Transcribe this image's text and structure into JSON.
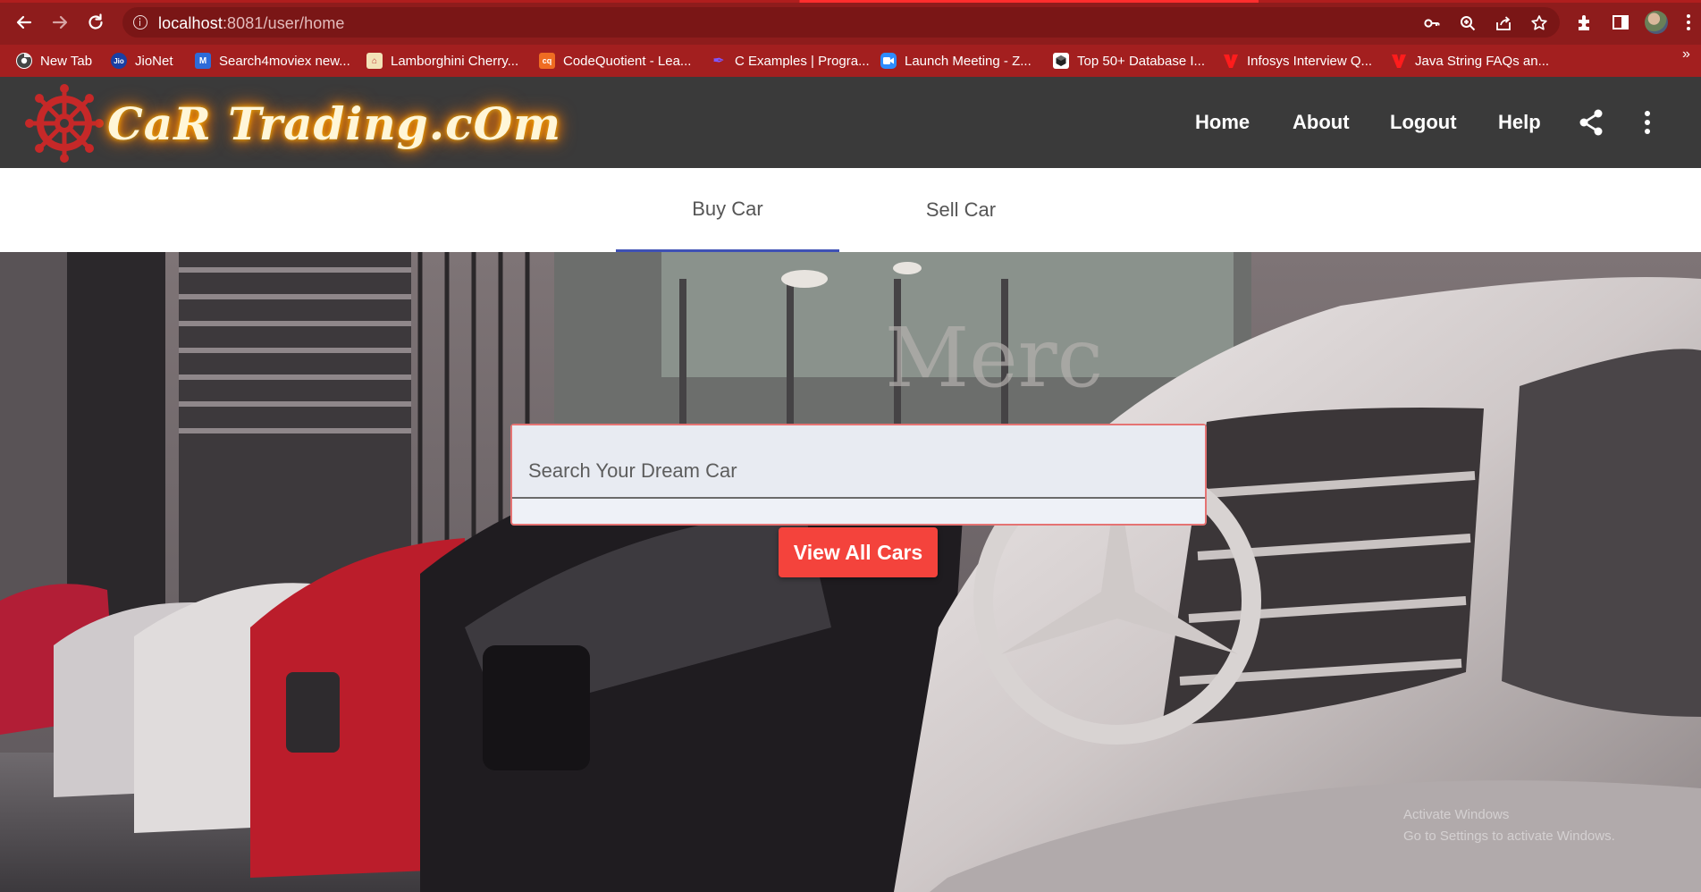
{
  "browser": {
    "url_host": "localhost",
    "url_path": ":8081/user/home",
    "colors": {
      "chrome": "#8e1c1c",
      "bookmarks": "#a31f1f"
    },
    "bookmarks": [
      {
        "label": "New Tab",
        "icon": "chrome-icon"
      },
      {
        "label": "JioNet",
        "icon": "jio-icon"
      },
      {
        "label": "Search4moviex new...",
        "icon": "m-icon"
      },
      {
        "label": "Lamborghini Cherry...",
        "icon": "store-icon"
      },
      {
        "label": "CodeQuotient - Lea...",
        "icon": "cq-icon"
      },
      {
        "label": "C Examples | Progra...",
        "icon": "pen-icon"
      },
      {
        "label": "Launch Meeting - Z...",
        "icon": "zoom-icon"
      },
      {
        "label": "Top 50+ Database I...",
        "icon": "cube-icon"
      },
      {
        "label": "Infosys Interview Q...",
        "icon": "v-icon"
      },
      {
        "label": "Java String FAQs an...",
        "icon": "v-icon"
      }
    ],
    "more_bookmarks": "»"
  },
  "header": {
    "logo_text": "CaR Trading.cOm",
    "nav": [
      "Home",
      "About",
      "Logout",
      "Help"
    ],
    "colors": {
      "background": "#3a3a3a",
      "logo_glow": "#ff8a00"
    }
  },
  "tabs": {
    "items": [
      "Buy Car",
      "Sell Car"
    ],
    "active": "Buy Car",
    "indicator_color": "#3f51b5"
  },
  "search": {
    "placeholder": "Search Your Dream Car",
    "value": ""
  },
  "actions": {
    "view_all": "View All Cars",
    "button_color": "#f4433c"
  },
  "watermark": {
    "line1": "Activate Windows",
    "line2": "Go to Settings to activate Windows."
  }
}
